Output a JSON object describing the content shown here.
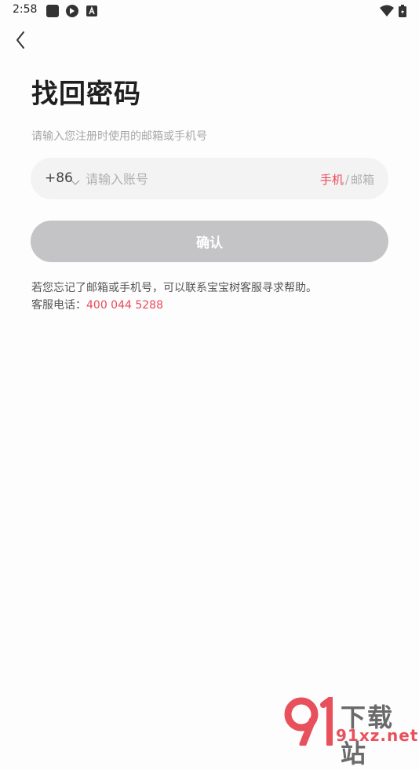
{
  "status_bar": {
    "time": "2:58",
    "icons": [
      "app-square-icon",
      "sync-icon",
      "font-a-icon",
      "wifi-icon",
      "battery-icon"
    ]
  },
  "page": {
    "title": "找回密码",
    "subtitle": "请输入您注册时使用的邮箱或手机号"
  },
  "account": {
    "country_code": "+86",
    "placeholder": "请输入账号",
    "value": "",
    "mode_phone": "手机",
    "mode_sep": "/",
    "mode_email": "邮箱"
  },
  "confirm_label": "确认",
  "help": {
    "line1": "若您忘记了邮箱或手机号，可以联系宝宝树客服寻求帮助。",
    "line2_prefix": "客服电话：",
    "phone": "400 044 5288"
  },
  "watermark": {
    "logo": "9",
    "top_text": "下载站",
    "bottom_text": "91xz.net"
  },
  "colors": {
    "accent": "#e84a5a",
    "button_disabled": "#c4c4c6",
    "field_bg": "#f3f3f4"
  }
}
